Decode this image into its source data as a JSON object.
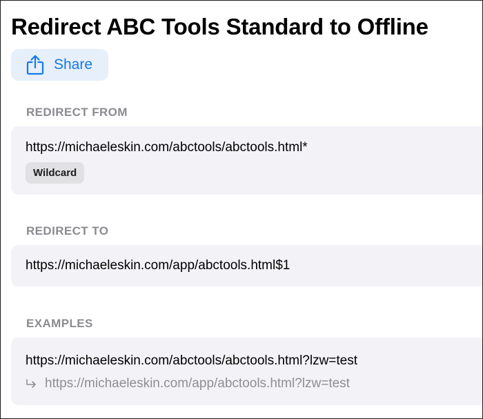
{
  "page": {
    "title": "Redirect ABC Tools Standard to Offline"
  },
  "share": {
    "label": "Share",
    "icon": "share-icon",
    "color": "#1479e8"
  },
  "redirect_from": {
    "header": "REDIRECT FROM",
    "url": "https://michaeleskin.com/abctools/abctools.html*",
    "badge": "Wildcard"
  },
  "redirect_to": {
    "header": "REDIRECT TO",
    "url": "https://michaeleskin.com/app/abctools.html$1"
  },
  "examples": {
    "header": "EXAMPLES",
    "items": [
      {
        "source": "https://michaeleskin.com/abctools/abctools.html?lzw=test",
        "result": "https://michaeleskin.com/app/abctools.html?lzw=test",
        "arrow_icon": "return-arrow-icon"
      }
    ]
  }
}
